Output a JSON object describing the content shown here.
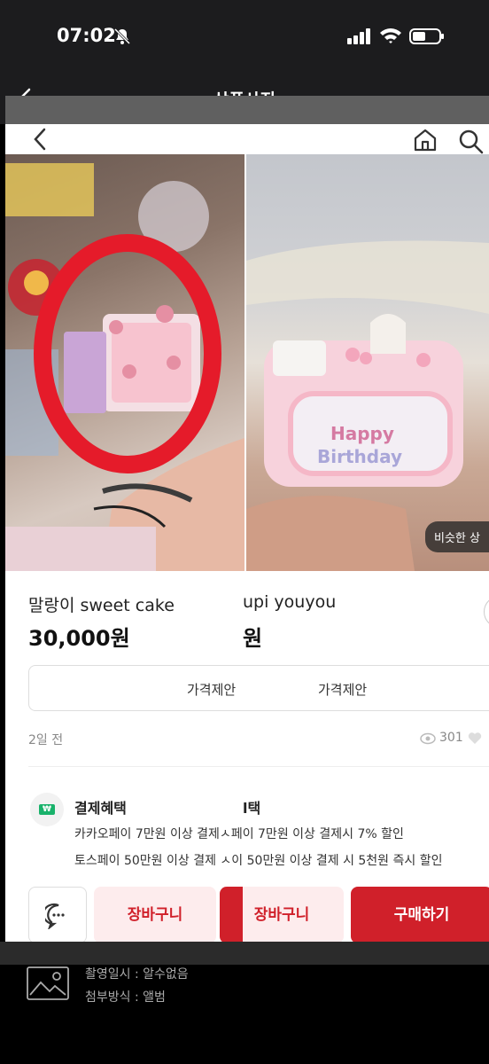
{
  "status_bar": {
    "time": "07:02"
  },
  "header": {
    "title": "상품사진"
  },
  "product": {
    "name_left": "말랑이 sweet cake",
    "name_right": "upi youyou",
    "price_left": "30,000원",
    "price_right": "원",
    "offer_label_left": "가격제안",
    "offer_label_right": "가격제안",
    "posted": "2일 전",
    "views": "301",
    "similar_badge": "비슷한 상",
    "payment": {
      "title_left": "결제혜택",
      "title_right": "l택",
      "line1": "카카오페이 7만원 이상 결제ㅅ페이 7만원 이상 결제시 7% 할인",
      "line2": "토스페이 50만원 이상 결제 ㅅ이 50만원 이상 결제 시 5천원 즉시 할인",
      "icon_label": "₩"
    }
  },
  "actions": {
    "cart_left": "장바구니",
    "cart_right": "장바구니",
    "buy": "구매하기"
  },
  "meta": {
    "line1": "촬영일시 : 알수없음",
    "line2": "첨부방식 : 앨범"
  },
  "colors": {
    "accent": "#d0202a",
    "accent_light": "#fdeced",
    "dark_bg": "#1c1c1e"
  },
  "icons": [
    "bell-slash-icon",
    "signal-icon",
    "wifi-icon",
    "battery-icon",
    "back-arrow-icon",
    "home-icon",
    "search-icon",
    "chat-icon",
    "eye-icon",
    "heart-icon",
    "image-placeholder-icon"
  ]
}
